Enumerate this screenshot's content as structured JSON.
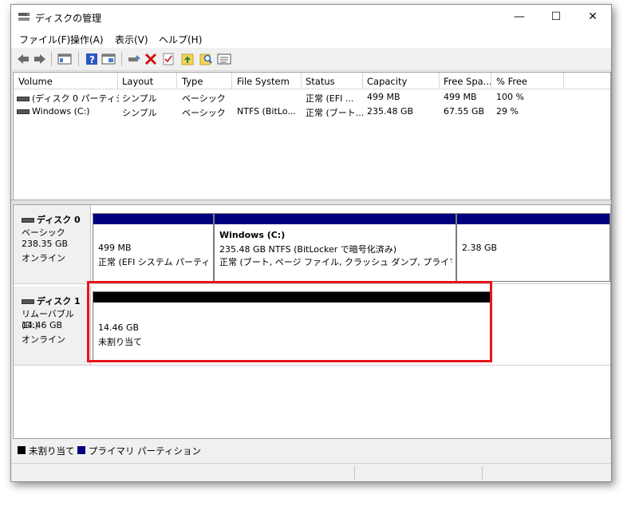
{
  "window": {
    "title": "ディスクの管理",
    "minimize": "—",
    "maximize": "☐",
    "close": "✕"
  },
  "menu": [
    "ファイル(F)",
    "操作(A)",
    "表示(V)",
    "ヘルプ(H)"
  ],
  "toolbar": {
    "icons": [
      "back-arrow-icon",
      "forward-arrow-icon",
      "console-tree-icon",
      "help-icon",
      "properties-icon",
      "connect-drive-icon",
      "delete-icon",
      "check-icon",
      "folder-up-icon",
      "search-icon",
      "list-icon"
    ]
  },
  "volume_list": {
    "columns": [
      "Volume",
      "Layout",
      "Type",
      "File System",
      "Status",
      "Capacity",
      "Free Spa...",
      "% Free"
    ],
    "rows": [
      [
        "(ディスク 0 パーティシ...",
        "シンプル",
        "ベーシック",
        "",
        "正常 (EFI ...",
        "499 MB",
        "499 MB",
        "100 %"
      ],
      [
        "Windows (C:)",
        "シンプル",
        "ベーシック",
        "NTFS (BitLo...",
        "正常 (ブート...",
        "235.48 GB",
        "67.55 GB",
        "29 %"
      ]
    ]
  },
  "disks": [
    {
      "name": "ディスク 0",
      "type": "ベーシック",
      "size": "238.35 GB",
      "status": "オンライン",
      "partitions": [
        {
          "title": "",
          "line1": "499 MB",
          "line2": "正常 (EFI システム パーティシ:"
        },
        {
          "title": "Windows  (C:)",
          "line1": "235.48 GB NTFS (BitLocker で暗号化済み)",
          "line2": "正常 (ブート, ページ ファイル, クラッシュ ダンプ, プライマリ パーテ·"
        },
        {
          "title": "",
          "line1": "2.38 GB",
          "line2": ""
        }
      ]
    },
    {
      "name": "ディスク 1",
      "type": "リムーバブル (D:)",
      "size": "14.46 GB",
      "status": "オンライン",
      "partitions": [
        {
          "title": "",
          "line1": "14.46 GB",
          "line2": "未割り当て"
        }
      ]
    }
  ],
  "legend": [
    {
      "label": "未割り当て",
      "color": "#000000"
    },
    {
      "label": "プライマリ パーティション",
      "color": "#00007f"
    }
  ],
  "colors": {
    "primary_partition": "#00007f",
    "unallocated": "#000000",
    "highlight": "#e8141a"
  }
}
